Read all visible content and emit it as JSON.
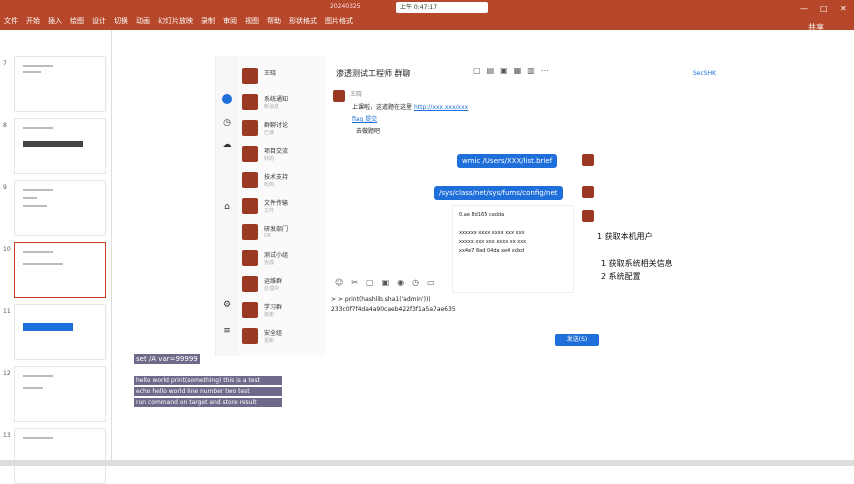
{
  "ribbon": {
    "tabs": [
      "文件",
      "开始",
      "插入",
      "绘图",
      "设计",
      "切换",
      "动画",
      "幻灯片放映",
      "录制",
      "审阅",
      "视图",
      "帮助",
      "形状格式",
      "图片格式"
    ],
    "title_prefix": "20240325",
    "title_box": "上午 0:47:17",
    "right_text": "共享"
  },
  "slides": {
    "numbers": [
      "7",
      "8",
      "9",
      "10",
      "11",
      "12",
      "13"
    ]
  },
  "chat": {
    "list": [
      {
        "name": "王晓",
        "preview": ""
      },
      {
        "name": "系统通知",
        "preview": "新消息"
      },
      {
        "name": "群聊讨论",
        "preview": "已读"
      },
      {
        "name": "项目交流",
        "preview": "好的"
      },
      {
        "name": "技术支持",
        "preview": "收到"
      },
      {
        "name": "文件传输",
        "preview": "文件"
      },
      {
        "name": "研发部门",
        "preview": "OK"
      },
      {
        "name": "测试小组",
        "preview": "完成"
      },
      {
        "name": "运维群",
        "preview": "处理中"
      },
      {
        "name": "学习群",
        "preview": "谢谢"
      },
      {
        "name": "安全组",
        "preview": "更新"
      }
    ],
    "title": "渗透测试工程师 群聊",
    "right_tag": "SecSHK",
    "sender_name": "王晓",
    "msg1": "上课啦，这道题在这里",
    "msg1_link": "http://xxx.xxx/xxx",
    "msg1_link2": "flag 提交",
    "msg1_note": "去做题吧",
    "bubble1": "wmic /Users/XXX/list.brief",
    "bubble2": "/sys/class/net/sys/fums/config/net",
    "card_title": "0.ae 8d165 cadda",
    "card_lines": [
      "xxxxxx xxxx xxxx xxx xxx",
      "xxxxx xxx xxx xxxx xx xxx",
      "xx4e7 8ad 04da xe4 xdxd"
    ],
    "input_line1": "> > print(hashlib.sha1('admin')))",
    "input_line2": "233c0f7f4da4a90caeb422f3f1a5a7ae635",
    "send_label": "发送(S)"
  },
  "slide_text": {
    "line1": "1 获取本机用户",
    "line2": "1 获取系统相关信息",
    "line3": "2 系统配置"
  },
  "notes": {
    "header": "set /A var=99999",
    "lines": [
      "hello world print(something) this is a test",
      "echo hello world line number two test",
      "run command on target and store result"
    ]
  },
  "colors": {
    "ribbon": "#b7472a",
    "bubble": "#1e6fd9"
  }
}
